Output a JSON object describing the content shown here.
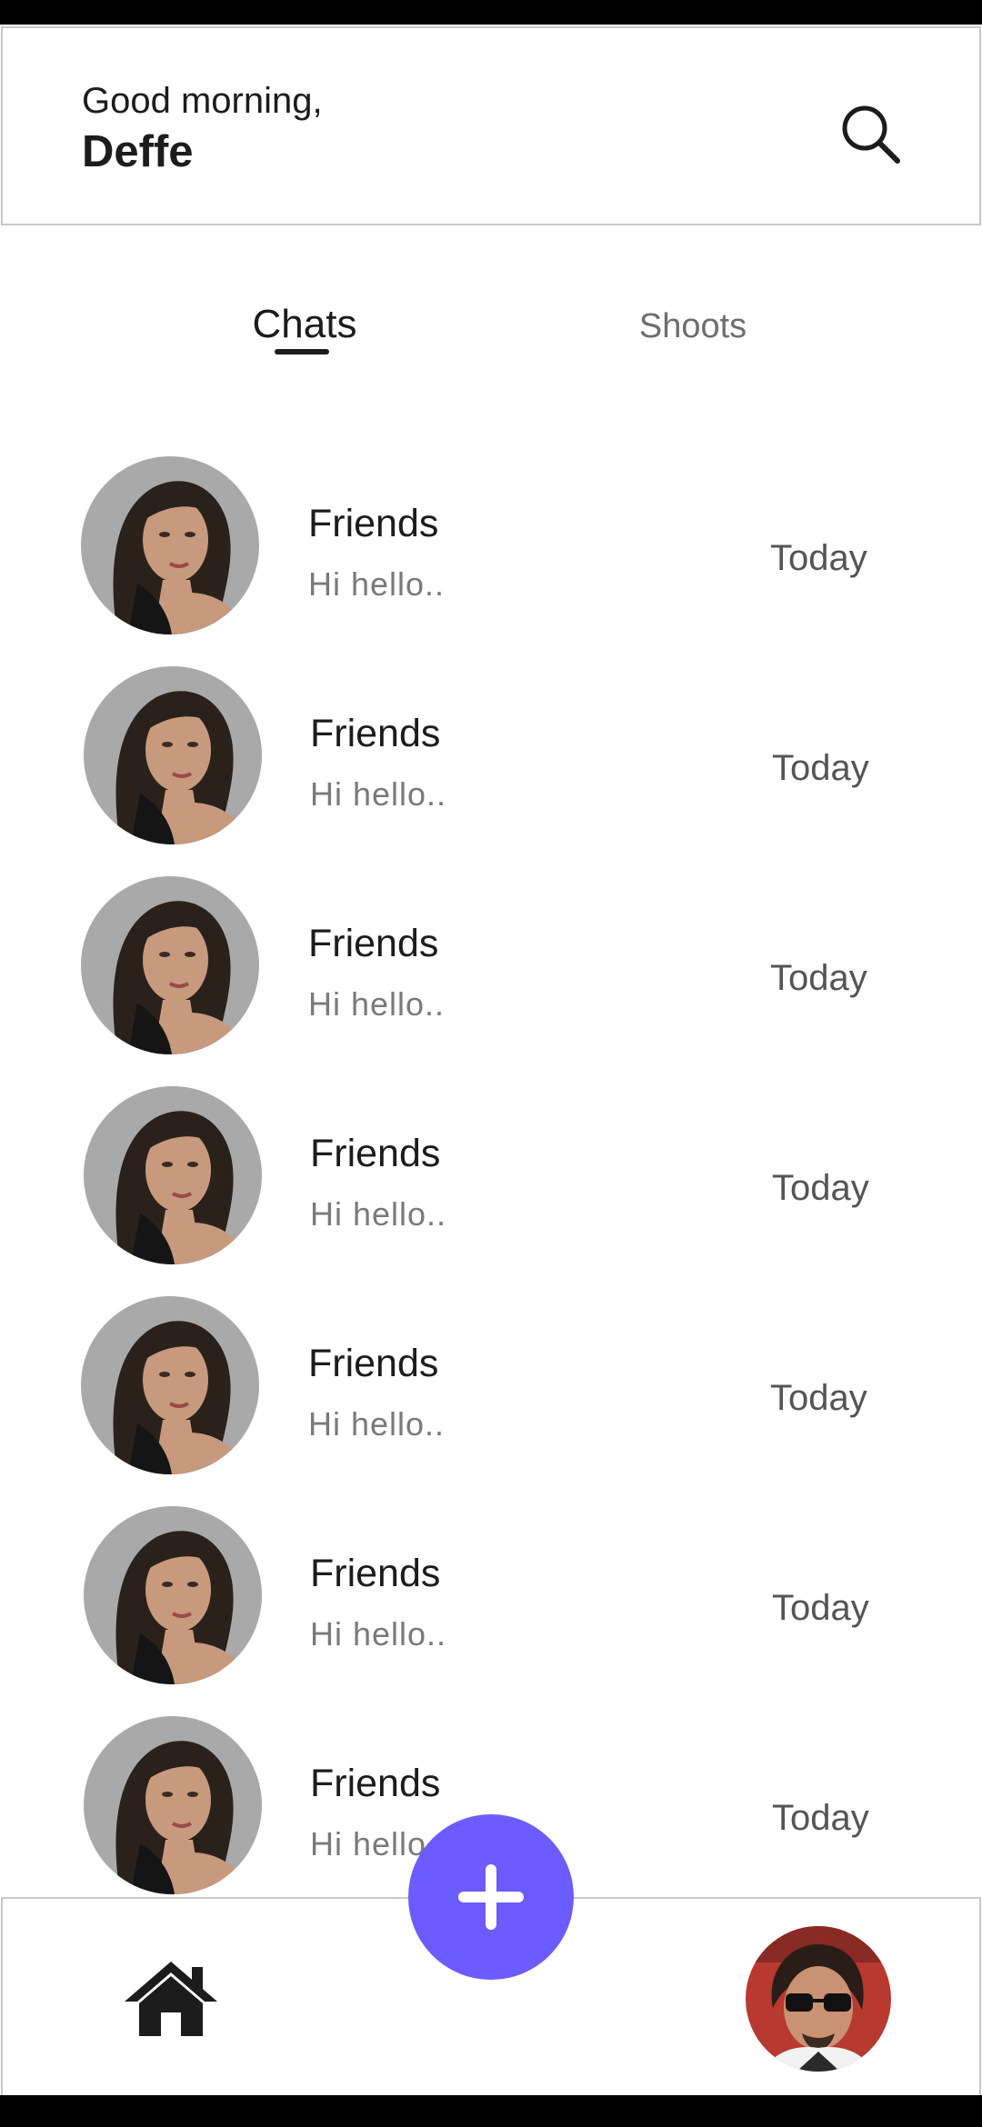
{
  "header": {
    "greeting": "Good morning,",
    "user_name": "Deffe"
  },
  "tabs": [
    {
      "label": "Chats",
      "active": true
    },
    {
      "label": "Shoots",
      "active": false
    }
  ],
  "chats": [
    {
      "name": "Friends",
      "preview": "Hi hello..",
      "time": "Today"
    },
    {
      "name": "Friends",
      "preview": "Hi hello..",
      "time": "Today"
    },
    {
      "name": "Friends",
      "preview": "Hi hello..",
      "time": "Today"
    },
    {
      "name": "Friends",
      "preview": "Hi hello..",
      "time": "Today"
    },
    {
      "name": "Friends",
      "preview": "Hi hello..",
      "time": "Today"
    },
    {
      "name": "Friends",
      "preview": "Hi hello..",
      "time": "Today"
    },
    {
      "name": "Friends",
      "preview": "Hi hello..",
      "time": "Today"
    }
  ],
  "icons": {
    "search": "search-icon",
    "home": "home-icon",
    "add": "plus-icon"
  },
  "colors": {
    "accent": "#6b5cff",
    "text_primary": "#1c1c1c",
    "text_secondary": "#7a7a7a"
  }
}
